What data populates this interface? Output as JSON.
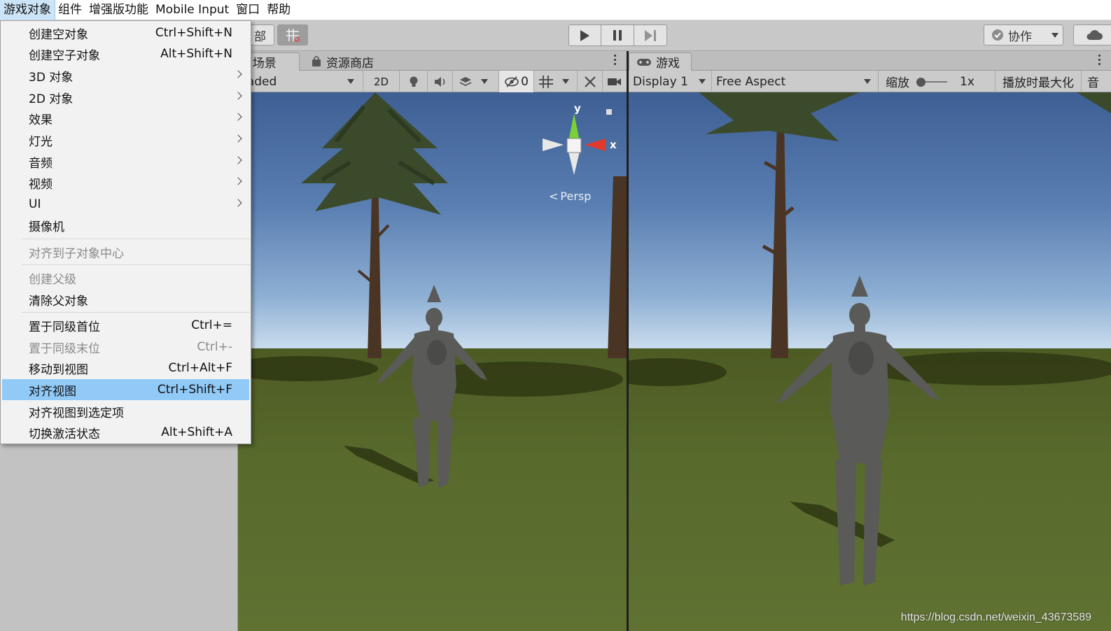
{
  "menubar": {
    "items": [
      "游戏对象",
      "组件",
      "增强版功能",
      "Mobile Input",
      "窗口",
      "帮助"
    ]
  },
  "toolbar": {
    "left_fragment": "部",
    "collab_label": "协作"
  },
  "context_menu": {
    "items": [
      {
        "label": "创建空对象",
        "shortcut": "Ctrl+Shift+N"
      },
      {
        "label": "创建空子对象",
        "shortcut": "Alt+Shift+N"
      },
      {
        "label": "3D 对象",
        "shortcut": ""
      },
      {
        "label": "2D 对象",
        "shortcut": ""
      },
      {
        "label": "效果",
        "shortcut": ""
      },
      {
        "label": "灯光",
        "shortcut": ""
      },
      {
        "label": "音频",
        "shortcut": ""
      },
      {
        "label": "视频",
        "shortcut": ""
      },
      {
        "label": "UI",
        "shortcut": ""
      },
      {
        "label": "摄像机",
        "shortcut": ""
      },
      {
        "label": "对齐到子对象中心",
        "shortcut": ""
      },
      {
        "label": "创建父级",
        "shortcut": ""
      },
      {
        "label": "清除父对象",
        "shortcut": ""
      },
      {
        "label": "置于同级首位",
        "shortcut": "Ctrl+="
      },
      {
        "label": "置于同级末位",
        "shortcut": "Ctrl+-"
      },
      {
        "label": "移动到视图",
        "shortcut": "Ctrl+Alt+F"
      },
      {
        "label": "对齐视图",
        "shortcut": "Ctrl+Shift+F"
      },
      {
        "label": "对齐视图到选定项",
        "shortcut": ""
      },
      {
        "label": "切换激活状态",
        "shortcut": "Alt+Shift+A"
      }
    ]
  },
  "scene": {
    "tab_scene": "场景",
    "tab_store": "资源商店",
    "shading_mode": "haded",
    "mode_2d": "2D",
    "hidden_count": "0",
    "gizmo_y": "y",
    "gizmo_x": "x",
    "persp_label": "Persp"
  },
  "game": {
    "tab_game": "游戏",
    "display": "Display 1",
    "aspect": "Free Aspect",
    "scale_label": "缩放",
    "scale_value": "1x",
    "maximize_label": "播放时最大化",
    "audio_fragment": "音"
  },
  "watermark": "https://blog.csdn.net/weixin_43673589",
  "colors": {
    "menu_highlight": "#91c9f7",
    "menubar_active": "#cce4f7",
    "panel_bg": "#c8c8c8",
    "sky_top": "#3e5f94",
    "ground": "#586a2c"
  }
}
